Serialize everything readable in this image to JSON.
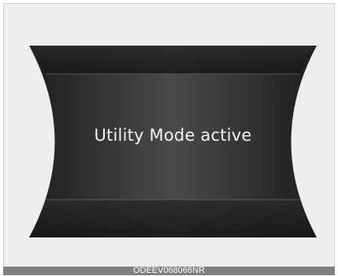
{
  "display": {
    "message": "Utility Mode active"
  },
  "caption": {
    "code": "ODEEV068066NR"
  },
  "colors": {
    "background": "#eeeeee",
    "panel_dark": "#2b2b2b",
    "panel_mid": "#444444",
    "text": "#f2f2f2",
    "caption_bar": "#7f7f7f"
  }
}
